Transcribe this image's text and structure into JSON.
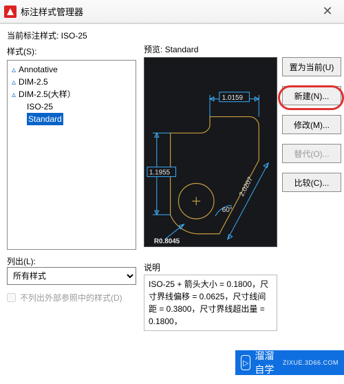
{
  "window": {
    "title": "标注样式管理器",
    "close_glyph": "✕"
  },
  "current_style": "当前标注样式: ISO-25",
  "styles_label": "样式(S):",
  "preview_label": "预览: Standard",
  "styles": {
    "i0": "Annotative",
    "i1": "DIM-2.5",
    "i2": "DIM-2.5(大样）",
    "i3": "ISO-25",
    "i4": "Standard"
  },
  "list_label": "列出(L):",
  "list_value": "所有样式",
  "checkbox_label": "不列出外部参照中的样式(D)",
  "buttons": {
    "set_current": "置为当前(U)",
    "new": "新建(N)...",
    "modify": "修改(M)...",
    "override": "替代(O)...",
    "compare": "比较(C)..."
  },
  "desc_label": "说明",
  "desc_text": "ISO-25 + 箭头大小 = 0.1800，尺寸界线偏移 = 0.0625，尺寸线间距 = 0.3800，尺寸界线超出量 = 0.1800，",
  "preview_dims": {
    "top": "1.0159",
    "left": "1.1955",
    "right": "2.0207",
    "angle": "60°",
    "radius": "R0.8045"
  },
  "watermark": {
    "brand": "溜溜自学",
    "sub": "ZIXUE.3D66.COM"
  }
}
